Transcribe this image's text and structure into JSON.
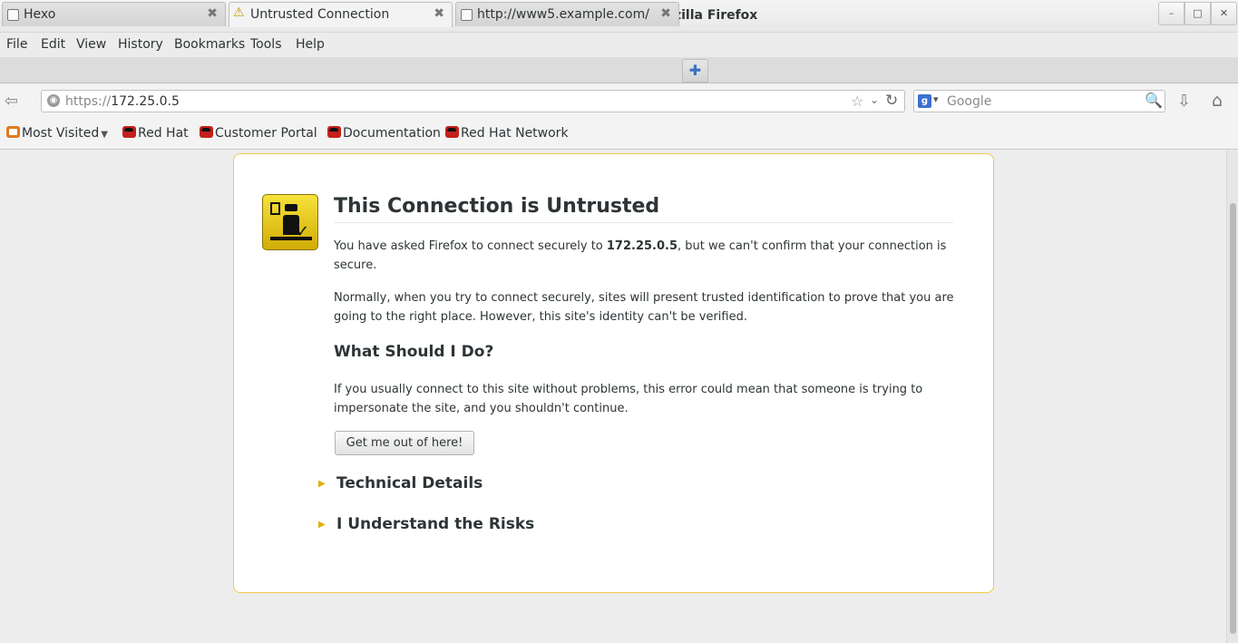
{
  "window": {
    "title": "Untrusted Connection – Mozilla Firefox",
    "minimize_glyph": "–",
    "maximize_glyph": "□",
    "close_glyph": "✕"
  },
  "menubar": {
    "items": [
      "File",
      "Edit",
      "View",
      "History",
      "Bookmarks",
      "Tools",
      "Help"
    ]
  },
  "tabs": [
    {
      "label": "Hexo",
      "active": false,
      "icon": "blank-page-icon"
    },
    {
      "label": "Untrusted Connection",
      "active": true,
      "icon": "warning-icon"
    },
    {
      "label": "http://www5.example.com/",
      "active": false,
      "icon": "blank-page-icon"
    }
  ],
  "tab_close_glyph": "✖",
  "new_tab_glyph": "✚",
  "navbar": {
    "url_scheme": "https://",
    "url_host": "172.25.0.5",
    "search_placeholder": "Google",
    "search_engine": "Google"
  },
  "bookmarks": [
    "Most Visited",
    "Red Hat",
    "Customer Portal",
    "Documentation",
    "Red Hat Network"
  ],
  "error_page": {
    "title": "This Connection is Untrusted",
    "intro_before": "You have asked Firefox to connect securely to ",
    "intro_host": "172.25.0.5",
    "intro_after": ", but we can't confirm that your connection is secure.",
    "paragraph2": "Normally, when you try to connect securely, sites will present trusted identification to prove that you are going to the right place. However, this site's identity can't be verified.",
    "what_to_do_heading": "What Should I Do?",
    "paragraph3": "If you usually connect to this site without problems, this error could mean that someone is trying to impersonate the site, and you shouldn't continue.",
    "escape_button": "Get me out of here!",
    "technical_details": "Technical Details",
    "understand_risks": "I Understand the Risks"
  },
  "colors": {
    "border_accent": "#f2c94c",
    "expander_triangle": "#e0b000",
    "redhat_red": "#c4201c"
  }
}
